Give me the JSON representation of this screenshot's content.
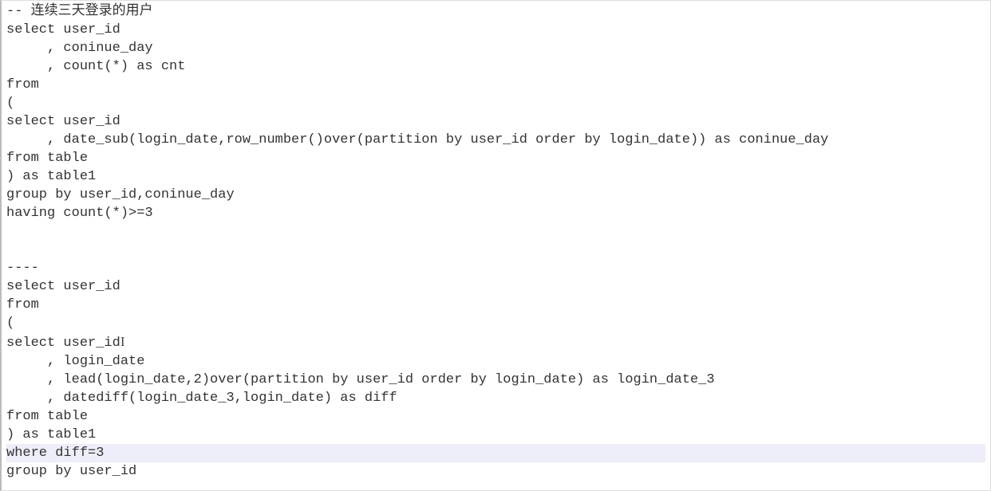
{
  "editor": {
    "lines": [
      "-- 连续三天登录的用户",
      "select user_id",
      "     , coninue_day",
      "     , count(*) as cnt",
      "from",
      "(",
      "select user_id",
      "     , date_sub(login_date,row_number()over(partition by user_id order by login_date)) as coninue_day",
      "from table",
      ") as table1",
      "group by user_id,coninue_day",
      "having count(*)>=3",
      "",
      "",
      "----",
      "select user_id",
      "from",
      "(",
      "select user_id",
      "     , login_date",
      "     , lead(login_date,2)over(partition by user_id order by login_date) as login_date_3",
      "     , datediff(login_date_3,login_date) as diff",
      "from table",
      ") as table1",
      "where diff=3",
      "group by user_id"
    ],
    "highlighted_line_index": 24,
    "cursor": {
      "line_index": 18,
      "column": 20
    }
  }
}
